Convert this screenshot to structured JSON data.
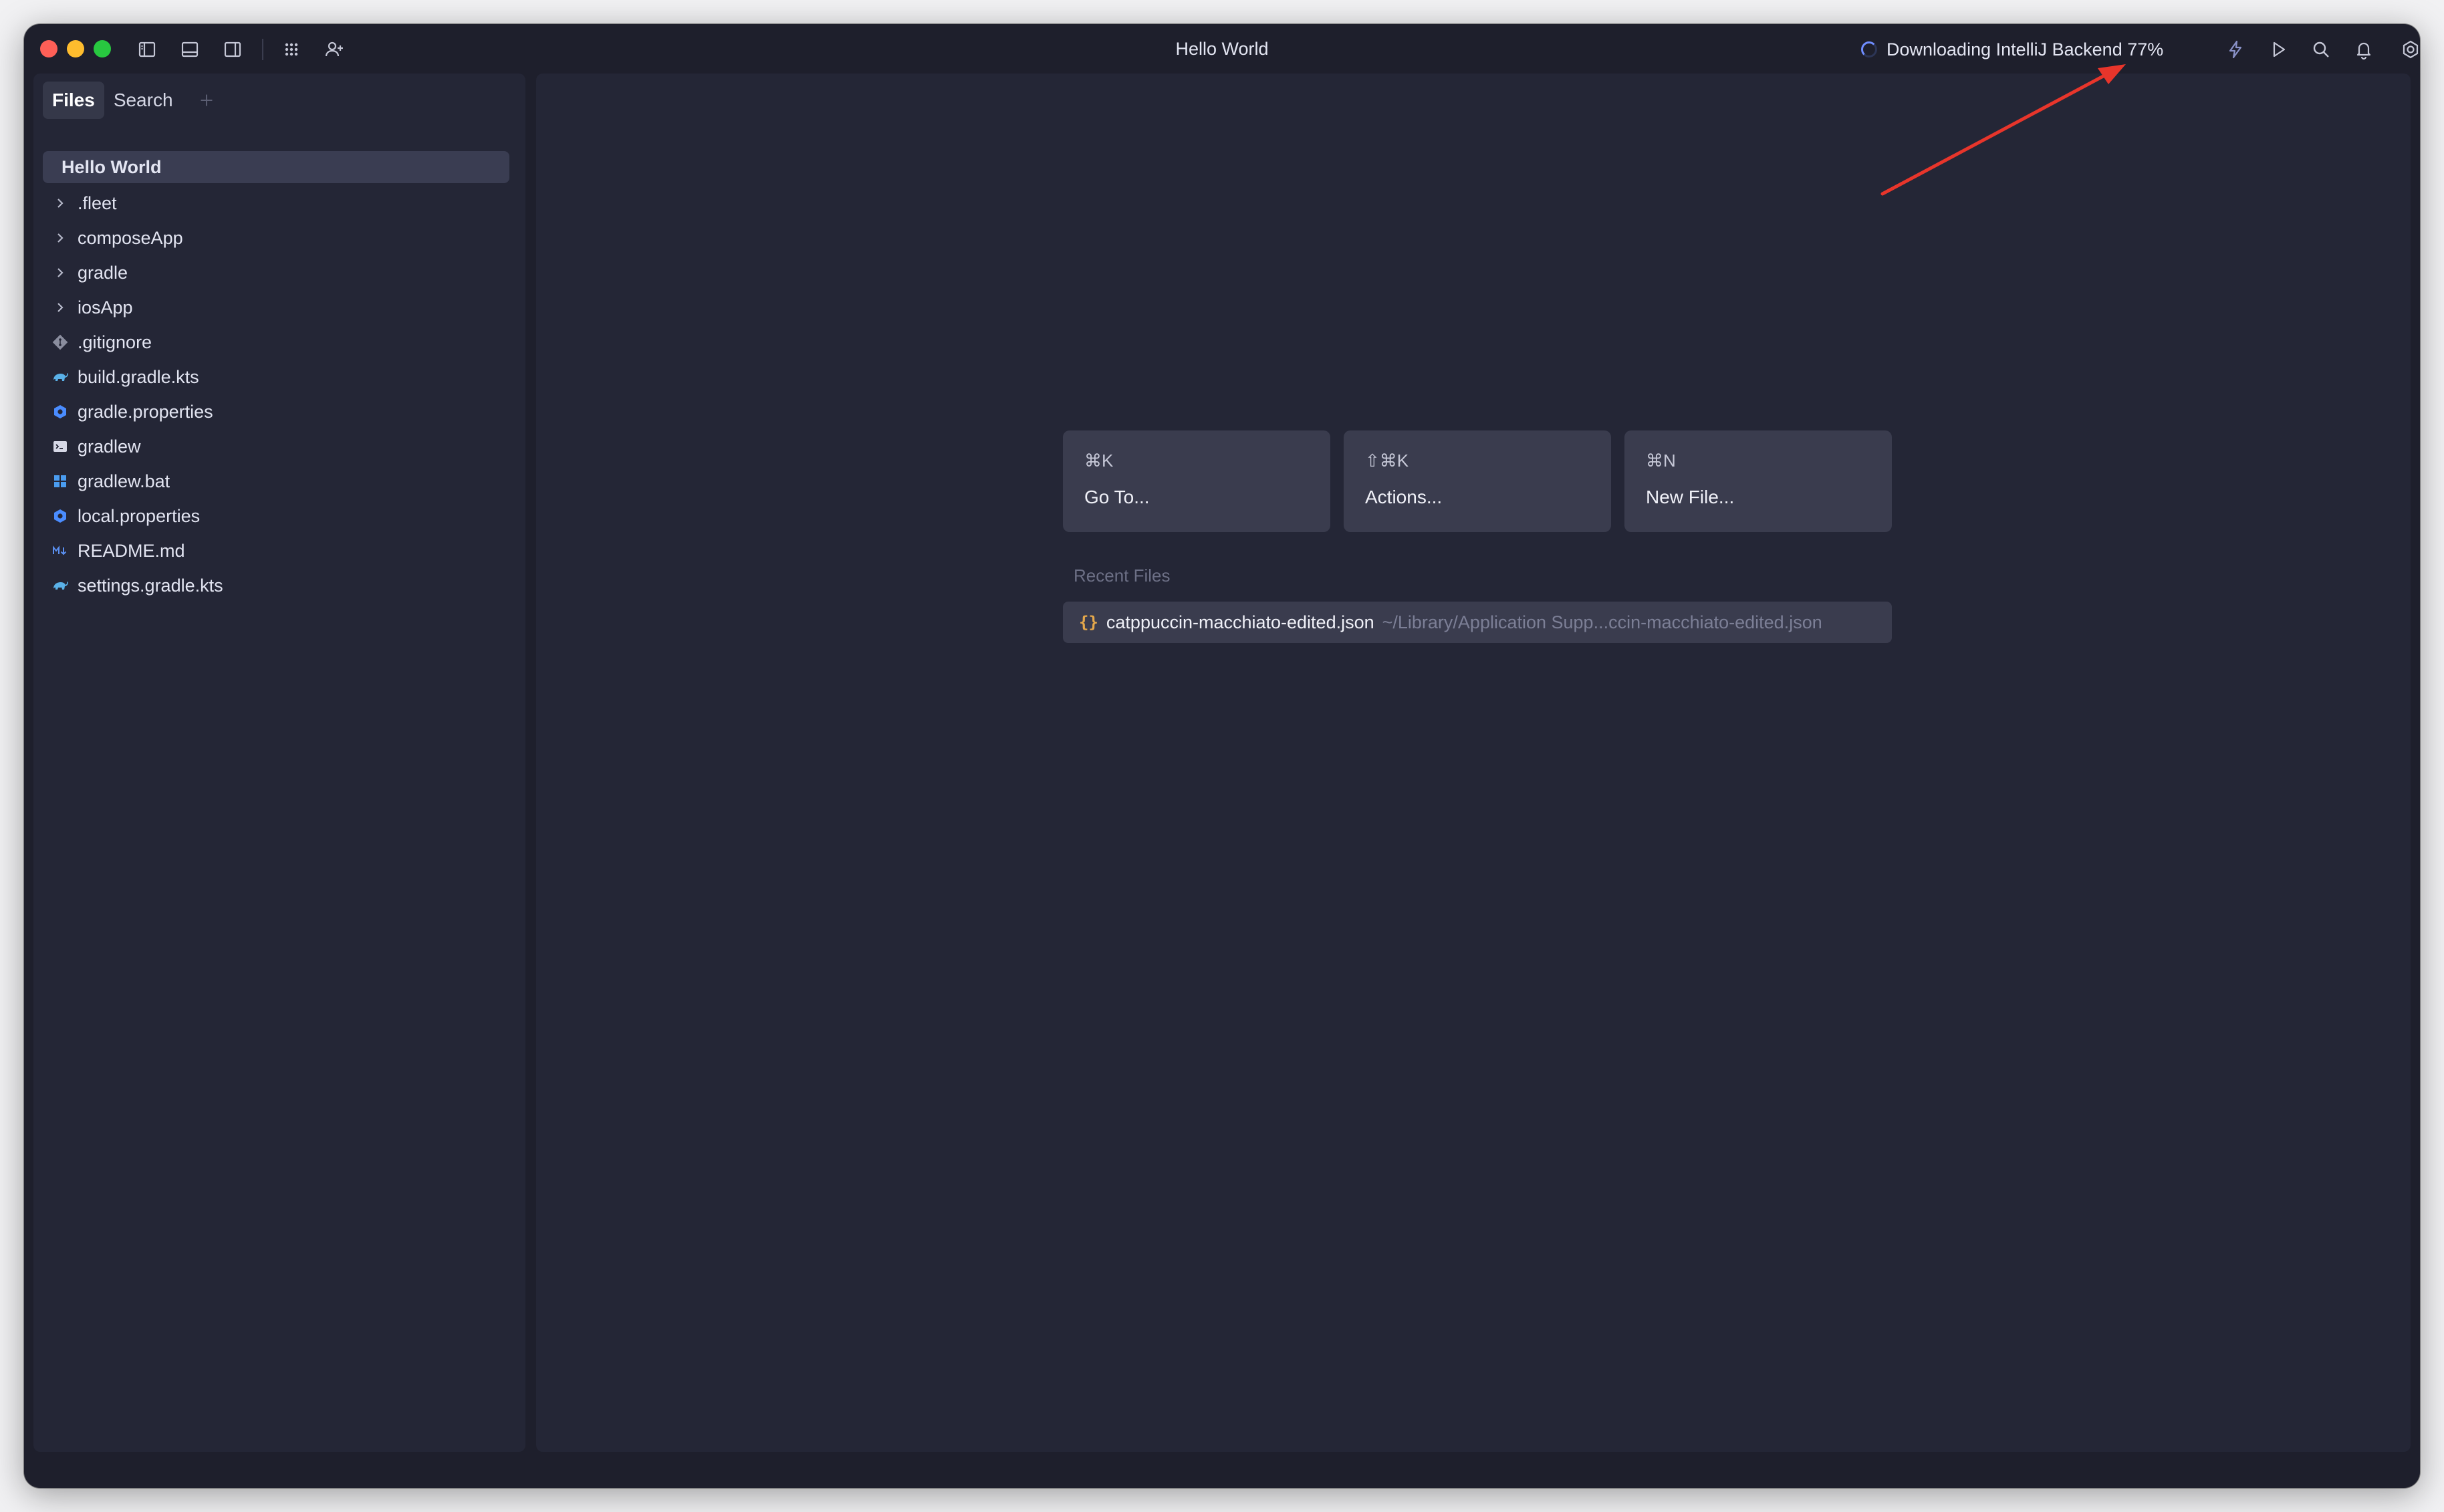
{
  "window": {
    "title": "Hello World",
    "status_text": "Downloading IntelliJ Backend 77%"
  },
  "icons": {
    "left_panel": "sidebar-left-icon",
    "bottom_panel": "panel-bottom-icon",
    "right_panel": "sidebar-right-icon",
    "apps": "grid-icon",
    "collaborate": "add-user-icon",
    "smart_mode": "lightning-icon",
    "run": "play-icon",
    "search": "search-icon",
    "notifications": "bell-icon",
    "settings": "gear-icon"
  },
  "sidebar": {
    "tabs": [
      {
        "label": "Files",
        "active": true
      },
      {
        "label": "Search",
        "active": false
      }
    ],
    "root": "Hello World",
    "items": [
      {
        "label": ".fleet",
        "icon": "chevron-right-icon"
      },
      {
        "label": "composeApp",
        "icon": "chevron-right-icon"
      },
      {
        "label": "gradle",
        "icon": "chevron-right-icon"
      },
      {
        "label": "iosApp",
        "icon": "chevron-right-icon"
      },
      {
        "label": ".gitignore",
        "icon": "git-icon"
      },
      {
        "label": "build.gradle.kts",
        "icon": "gradle-icon"
      },
      {
        "label": "gradle.properties",
        "icon": "properties-icon"
      },
      {
        "label": "gradlew",
        "icon": "terminal-icon"
      },
      {
        "label": "gradlew.bat",
        "icon": "windows-icon"
      },
      {
        "label": "local.properties",
        "icon": "properties-icon"
      },
      {
        "label": "README.md",
        "icon": "markdown-icon"
      },
      {
        "label": "settings.gradle.kts",
        "icon": "gradle-icon"
      }
    ]
  },
  "main": {
    "cards": [
      {
        "shortcut": "⌘K",
        "label": "Go To..."
      },
      {
        "shortcut": "⇧⌘K",
        "label": "Actions..."
      },
      {
        "shortcut": "⌘N",
        "label": "New File..."
      }
    ],
    "recent_title": "Recent Files",
    "recent_files": [
      {
        "name": "catppuccin-macchiato-edited.json",
        "path": "~/Library/Application Supp...ccin-macchiato-edited.json"
      }
    ]
  },
  "colors": {
    "window_bg": "#1e1f2c",
    "panel_bg": "#242636",
    "card_bg": "#3a3c4e",
    "accent_blue": "#4a8cff",
    "annotation_red": "#e8352b",
    "json_icon": "#e5a84b"
  }
}
